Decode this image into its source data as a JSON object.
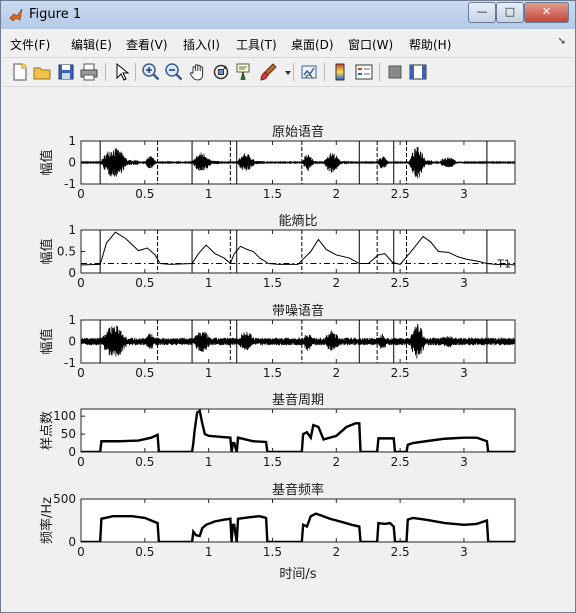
{
  "window": {
    "title": "Figure 1"
  },
  "window_buttons": {
    "minimize": "—",
    "maximize": "□",
    "close": "✕"
  },
  "menu": [
    "文件(F)",
    "编辑(E)",
    "查看(V)",
    "插入(I)",
    "工具(T)",
    "桌面(D)",
    "窗口(W)",
    "帮助(H)"
  ],
  "toolbar_icons": [
    "new-figure-icon",
    "open-file-icon",
    "save-icon",
    "print-icon",
    "pointer-icon",
    "zoom-in-icon",
    "zoom-out-icon",
    "pan-hand-icon",
    "rotate-3d-icon",
    "data-cursor-icon",
    "brush-icon",
    "brush-dropdown-icon",
    "link-plot-icon",
    "colorbar-icon",
    "legend-icon",
    "hide-plot-tools-icon",
    "show-plot-tools-icon"
  ],
  "figure": {
    "xlabel": "时间/s"
  },
  "markers": [
    0.15,
    0.6,
    0.87,
    1.17,
    1.22,
    1.73,
    2.18,
    2.32,
    2.45,
    2.55,
    3.18
  ],
  "chart_data": [
    {
      "type": "line",
      "title": "原始语音",
      "ylabel": "幅值",
      "xlim": [
        0,
        3.4
      ],
      "ylim": [
        -1,
        1
      ],
      "yticks": [
        "1",
        "0",
        "-1"
      ],
      "xticks": [
        "0",
        "0.5",
        "1",
        "1.5",
        "2",
        "2.5",
        "3"
      ],
      "series": [
        {
          "segments": [
            [
              0.15,
              0.45,
              0.8
            ],
            [
              0.5,
              0.62,
              0.35
            ],
            [
              0.87,
              1.08,
              0.55
            ],
            [
              1.22,
              1.42,
              0.5
            ],
            [
              1.73,
              1.86,
              0.45
            ],
            [
              1.9,
              2.08,
              0.55
            ],
            [
              2.32,
              2.44,
              0.35
            ],
            [
              2.57,
              2.75,
              0.85
            ],
            [
              2.8,
              3.0,
              0.3
            ]
          ]
        }
      ],
      "color": "#000000"
    },
    {
      "type": "line",
      "title": "能熵比",
      "ylabel": "幅值",
      "xlim": [
        0,
        3.4
      ],
      "ylim": [
        0,
        1
      ],
      "yticks": [
        "1",
        "0.5",
        "0"
      ],
      "xticks": [
        "0",
        "0.5",
        "1",
        "1.5",
        "2",
        "2.5",
        "3"
      ],
      "threshold": {
        "value": 0.22,
        "label": "T1"
      },
      "series": [
        {
          "x": [
            0,
            0.15,
            0.2,
            0.27,
            0.35,
            0.45,
            0.52,
            0.58,
            0.62,
            0.7,
            0.87,
            0.92,
            0.98,
            1.05,
            1.12,
            1.17,
            1.2,
            1.25,
            1.3,
            1.35,
            1.4,
            1.47,
            1.55,
            1.7,
            1.75,
            1.8,
            1.86,
            1.92,
            2.0,
            2.1,
            2.18,
            2.25,
            2.33,
            2.38,
            2.44,
            2.5,
            2.6,
            2.68,
            2.74,
            2.8,
            2.88,
            2.95,
            3.02,
            3.1,
            3.18,
            3.25,
            3.4
          ],
          "y": [
            0.19,
            0.2,
            0.7,
            0.95,
            0.8,
            0.52,
            0.58,
            0.42,
            0.22,
            0.2,
            0.22,
            0.45,
            0.65,
            0.45,
            0.35,
            0.22,
            0.45,
            0.62,
            0.55,
            0.5,
            0.35,
            0.22,
            0.2,
            0.2,
            0.35,
            0.5,
            0.78,
            0.55,
            0.42,
            0.35,
            0.22,
            0.22,
            0.42,
            0.45,
            0.25,
            0.2,
            0.55,
            0.85,
            0.72,
            0.5,
            0.48,
            0.38,
            0.32,
            0.28,
            0.22,
            0.2,
            0.19
          ]
        }
      ],
      "color": "#000000"
    },
    {
      "type": "line",
      "title": "带噪语音",
      "ylabel": "幅值",
      "xlim": [
        0,
        3.4
      ],
      "ylim": [
        -1,
        1
      ],
      "yticks": [
        "1",
        "0",
        "-1"
      ],
      "xticks": [
        "0",
        "0.5",
        "1",
        "1.5",
        "2",
        "2.5",
        "3"
      ],
      "series": [
        {
          "noise_level": 0.18,
          "segments": [
            [
              0.15,
              0.45,
              0.9
            ],
            [
              0.5,
              0.62,
              0.45
            ],
            [
              0.87,
              1.08,
              0.6
            ],
            [
              1.22,
              1.42,
              0.55
            ],
            [
              1.73,
              1.86,
              0.5
            ],
            [
              1.9,
              2.08,
              0.6
            ],
            [
              2.32,
              2.44,
              0.45
            ],
            [
              2.57,
              2.75,
              0.95
            ],
            [
              2.8,
              3.0,
              0.35
            ]
          ]
        }
      ],
      "color": "#000000"
    },
    {
      "type": "line",
      "title": "基音周期",
      "ylabel": "样点数",
      "xlim": [
        0,
        3.4
      ],
      "ylim": [
        0,
        120
      ],
      "yticks": [
        "100",
        "50",
        "0"
      ],
      "xticks": [
        "0",
        "0.5",
        "1",
        "1.5",
        "2",
        "2.5",
        "3"
      ],
      "series": [
        {
          "x": [
            0,
            0.15,
            0.16,
            0.3,
            0.45,
            0.55,
            0.6,
            0.61,
            0.87,
            0.88,
            0.89,
            0.91,
            0.93,
            0.95,
            0.97,
            1.0,
            1.1,
            1.17,
            1.18,
            1.19,
            1.2,
            1.22,
            1.23,
            1.35,
            1.45,
            1.46,
            1.73,
            1.74,
            1.77,
            1.8,
            1.82,
            1.86,
            1.9,
            2.0,
            2.08,
            2.15,
            2.18,
            2.19,
            2.32,
            2.33,
            2.45,
            2.46,
            2.55,
            2.56,
            2.6,
            2.7,
            2.85,
            3.0,
            3.1,
            3.18,
            3.19,
            3.4
          ],
          "y": [
            0,
            0,
            30,
            30,
            32,
            40,
            48,
            0,
            0,
            25,
            60,
            110,
            115,
            80,
            50,
            45,
            42,
            40,
            0,
            25,
            25,
            0,
            40,
            30,
            28,
            0,
            0,
            50,
            55,
            40,
            75,
            70,
            35,
            45,
            70,
            80,
            80,
            0,
            0,
            38,
            38,
            0,
            0,
            20,
            25,
            30,
            37,
            40,
            40,
            30,
            0,
            0
          ]
        }
      ],
      "color": "#000000"
    },
    {
      "type": "line",
      "title": "基音频率",
      "ylabel": "频率/Hz",
      "xlim": [
        0,
        3.4
      ],
      "ylim": [
        0,
        500
      ],
      "yticks": [
        "500",
        "0"
      ],
      "xticks": [
        "0",
        "0.5",
        "1",
        "1.5",
        "2",
        "2.5",
        "3"
      ],
      "series": [
        {
          "x": [
            0,
            0.15,
            0.16,
            0.25,
            0.4,
            0.5,
            0.55,
            0.6,
            0.61,
            0.87,
            0.88,
            0.9,
            0.93,
            0.95,
            0.98,
            1.05,
            1.12,
            1.17,
            1.18,
            1.19,
            1.2,
            1.22,
            1.23,
            1.33,
            1.4,
            1.45,
            1.46,
            1.73,
            1.74,
            1.77,
            1.8,
            1.84,
            1.88,
            1.95,
            2.05,
            2.12,
            2.18,
            2.19,
            2.32,
            2.33,
            2.38,
            2.42,
            2.45,
            2.46,
            2.55,
            2.56,
            2.6,
            2.7,
            2.85,
            3.0,
            3.1,
            3.18,
            3.19,
            3.4
          ],
          "y": [
            0,
            0,
            270,
            300,
            300,
            280,
            250,
            220,
            0,
            0,
            120,
            80,
            70,
            160,
            200,
            240,
            260,
            270,
            0,
            200,
            200,
            0,
            270,
            290,
            300,
            280,
            0,
            0,
            200,
            180,
            300,
            330,
            310,
            270,
            230,
            200,
            180,
            0,
            0,
            220,
            210,
            220,
            180,
            0,
            0,
            260,
            280,
            260,
            220,
            200,
            210,
            250,
            0,
            0
          ]
        }
      ],
      "color": "#000000"
    }
  ]
}
